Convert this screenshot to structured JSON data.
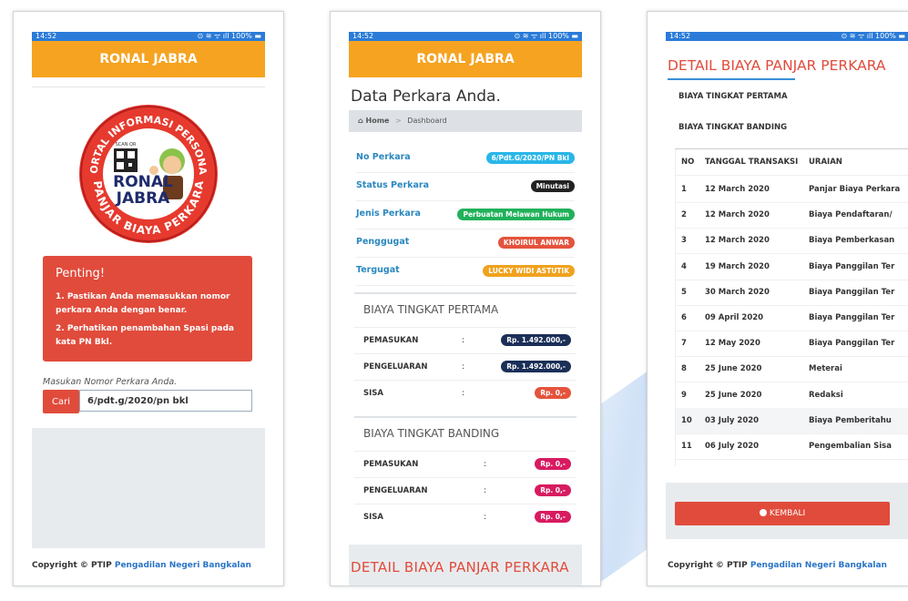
{
  "status": {
    "time": "14:52",
    "icons": "⊙ ≋ ᯤ ıll 100% ▬"
  },
  "app": {
    "title": "RONAL JABRA"
  },
  "screen1": {
    "logo": {
      "ring_top": "PORTAL INFORMASI PERSONAL",
      "ring_bottom": "PANJAR BIAYA PERKARA",
      "name_line1": "RONAL",
      "name_line2": "JABRA",
      "qr_label": "SCAN QR"
    },
    "alert": {
      "title": "Penting!",
      "line1a": "1. Pastikan Anda memasukkan nomor",
      "line1b": "perkara Anda dengan benar.",
      "line2a": "2. Perhatikan penambahan Spasi pada",
      "line2b": "kata PN Bkl."
    },
    "search": {
      "hint": "Masukan Nomor Perkara Anda.",
      "button": "Cari",
      "value": "6/pdt.g/2020/pn bkl"
    },
    "copyright_prefix": "Copyright © PTIP ",
    "copyright_link": "Pengadilan Negeri Bangkalan"
  },
  "screen2": {
    "page_title": "Data Perkara Anda.",
    "breadcrumb": {
      "home": "Home",
      "sep": ">",
      "current": "Dashboard"
    },
    "info": [
      {
        "label": "No Perkara",
        "value": "6/Pdt.G/2020/PN Bkl",
        "color": "#29b6e8"
      },
      {
        "label": "Status Perkara",
        "value": "Minutasi",
        "color": "#222222"
      },
      {
        "label": "Jenis Perkara",
        "value": "Perbuatan Melawan Hukum",
        "color": "#20b15a"
      },
      {
        "label": "Penggugat",
        "value": "KHOIRUL ANWAR",
        "color": "#e4533d"
      },
      {
        "label": "Tergugat",
        "value": "LUCKY WIDI ASTUTIK",
        "color": "#f0a21e"
      }
    ],
    "pertama": {
      "title": "BIAYA TINGKAT PERTAMA",
      "rows": [
        {
          "label": "PEMASUKAN",
          "colon": ":",
          "value": "Rp. 1.492.000,-",
          "color": "#1b2f57"
        },
        {
          "label": "PENGELUARAN",
          "colon": ":",
          "value": "Rp. 1.492.000,-",
          "color": "#1b2f57"
        },
        {
          "label": "SISA",
          "colon": ":",
          "value": "Rp. 0,-",
          "color": "#e4533d"
        }
      ]
    },
    "banding": {
      "title": "BIAYA TINGKAT BANDING",
      "rows": [
        {
          "label": "PEMASUKAN",
          "colon": ":",
          "value": "Rp. 0,-",
          "color": "#d81b60"
        },
        {
          "label": "PENGELUARAN",
          "colon": ":",
          "value": "Rp. 0,-",
          "color": "#d81b60"
        },
        {
          "label": "SISA",
          "colon": ":",
          "value": "Rp. 0,-",
          "color": "#d81b60"
        }
      ]
    },
    "bottom_title": "DETAIL BIAYA PANJAR PERKARA"
  },
  "screen3": {
    "title": "DETAIL BIAYA PANJAR PERKARA",
    "tab1": "BIAYA TINGKAT PERTAMA",
    "tab2": "BIAYA TINGKAT BANDING",
    "headers": [
      "NO",
      "TANGGAL TRANSAKSI",
      "URAIAN"
    ],
    "rows": [
      [
        "1",
        "12 March 2020",
        "Panjar Biaya Perkara"
      ],
      [
        "2",
        "12 March 2020",
        "Biaya Pendaftaran/"
      ],
      [
        "3",
        "12 March 2020",
        "Biaya Pemberkasan"
      ],
      [
        "4",
        "19 March 2020",
        "Biaya Panggilan Ter"
      ],
      [
        "5",
        "30 March 2020",
        "Biaya Panggilan Ter"
      ],
      [
        "6",
        "09 April 2020",
        "Biaya Panggilan Ter"
      ],
      [
        "7",
        "12 May 2020",
        "Biaya Panggilan Ter"
      ],
      [
        "8",
        "25 June 2020",
        "Meterai"
      ],
      [
        "9",
        "25 June 2020",
        "Redaksi"
      ],
      [
        "10",
        "03 July 2020",
        "Biaya Pemberitahu"
      ],
      [
        "11",
        "06 July 2020",
        "Pengembalian Sisa"
      ]
    ],
    "back_button": "KEMBALI",
    "copyright_prefix": "Copyright © PTIP ",
    "copyright_link": "Pengadilan Negeri Bangkalan"
  }
}
